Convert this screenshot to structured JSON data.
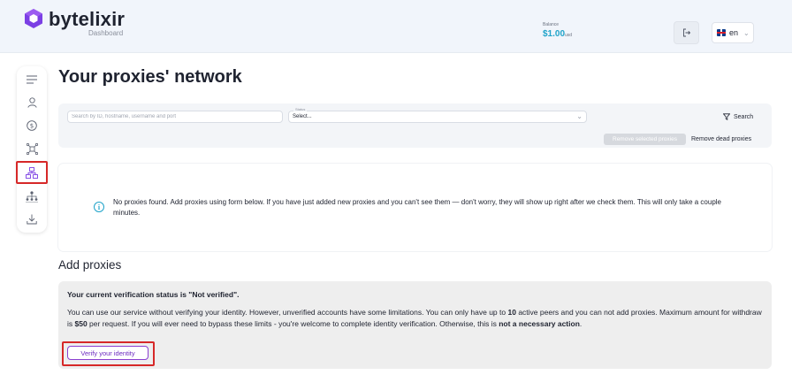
{
  "header": {
    "brand": "bytelixir",
    "subtitle": "Dashboard",
    "balance_label": "Balance",
    "balance_value": "$1.00",
    "balance_unit": "usd",
    "language": "en"
  },
  "colors": {
    "accent_purple": "#8b3fd1",
    "balance_teal": "#1fa3c9",
    "highlight_red": "#d62828"
  },
  "sidebar": {
    "items": [
      {
        "icon": "menu-icon"
      },
      {
        "icon": "user-icon"
      },
      {
        "icon": "dollar-icon"
      },
      {
        "icon": "proxy-nodes-icon"
      },
      {
        "icon": "network-icon",
        "active": true
      },
      {
        "icon": "hierarchy-icon"
      },
      {
        "icon": "download-icon"
      }
    ]
  },
  "main": {
    "title": "Your proxies' network",
    "filters": {
      "search_placeholder": "Search by ID, hostname, username and port",
      "status_label": "Status",
      "status_value": "Select...",
      "search_button": "Search",
      "remove_selected": "Remove selected proxies",
      "remove_dead": "Remove dead proxies"
    },
    "empty_message": "No proxies found. Add proxies using form below. If you have just added new proxies and you can't see them — don't worry, they will show up right after we check them. This will only take a couple minutes.",
    "add_section": {
      "title": "Add proxies",
      "verify_title": "Your current verification status is \"Not verified\".",
      "text_1": "You can use our service without verifying your identity. However, unverified accounts have some limitations. You can only have up to ",
      "peers": "10",
      "text_2": " active peers and you can not add proxies. Maximum amount for withdraw is ",
      "max_withdraw": "$50",
      "text_3": " per request. If you will ever need to bypass these limits - you're welcome to complete identity verification. Otherwise, this is ",
      "not_necessary": "not a necessary action",
      "text_4": ".",
      "verify_button": "Verify your identity"
    }
  }
}
